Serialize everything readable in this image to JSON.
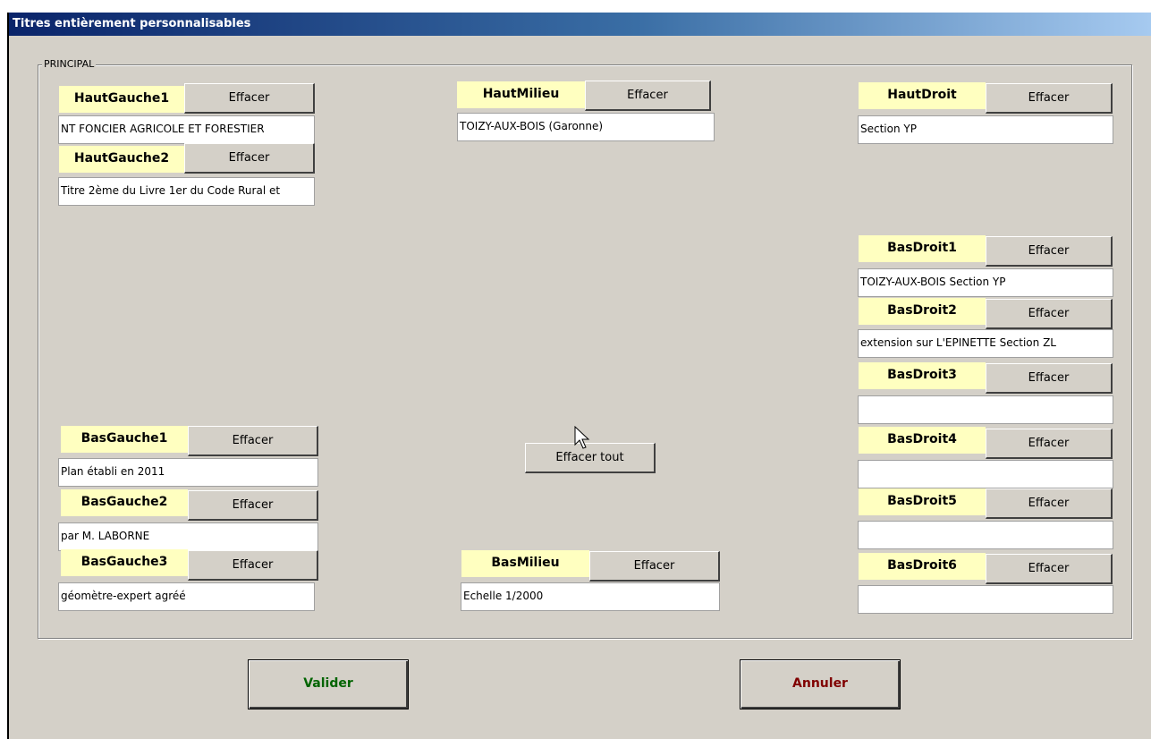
{
  "window": {
    "title": "Titres entièrement personnalisables"
  },
  "group": {
    "label": "PRINCIPAL"
  },
  "clear_label": "Effacer",
  "fields": {
    "haut_gauche_1": {
      "label": "HautGauche1",
      "value": "NT FONCIER AGRICOLE ET FORESTIER"
    },
    "haut_gauche_2": {
      "label": "HautGauche2",
      "value": "Titre 2ème du Livre 1er du Code Rural et"
    },
    "haut_milieu": {
      "label": "HautMilieu",
      "value": "TOIZY-AUX-BOIS (Garonne)"
    },
    "haut_droit": {
      "label": "HautDroit",
      "value": "Section YP"
    },
    "bas_droit_1": {
      "label": "BasDroit1",
      "value": "TOIZY-AUX-BOIS Section YP"
    },
    "bas_droit_2": {
      "label": "BasDroit2",
      "value": "extension sur L'EPINETTE Section ZL"
    },
    "bas_droit_3": {
      "label": "BasDroit3",
      "value": ""
    },
    "bas_droit_4": {
      "label": "BasDroit4",
      "value": ""
    },
    "bas_droit_5": {
      "label": "BasDroit5",
      "value": ""
    },
    "bas_droit_6": {
      "label": "BasDroit6",
      "value": ""
    },
    "bas_gauche_1": {
      "label": "BasGauche1",
      "value": "Plan établi en 2011"
    },
    "bas_gauche_2": {
      "label": "BasGauche2",
      "value": "par M. LABORNE"
    },
    "bas_gauche_3": {
      "label": "BasGauche3",
      "value": "géomètre-expert agréé"
    },
    "bas_milieu": {
      "label": "BasMilieu",
      "value": "Echelle 1/2000"
    }
  },
  "clear_all_label": "Effacer tout",
  "validate": {
    "label": "Valider",
    "color": "#006400"
  },
  "cancel": {
    "label": "Annuler",
    "color": "#800000"
  }
}
